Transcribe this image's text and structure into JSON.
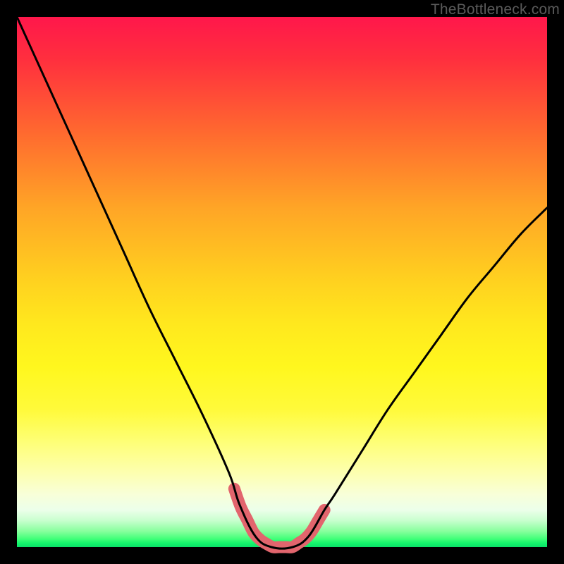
{
  "watermark": "TheBottleneck.com",
  "colors": {
    "curve": "#000000",
    "highlight": "#e2656d",
    "background_top": "#ff174b",
    "background_bottom": "#0ce06a",
    "frame": "#000000"
  },
  "chart_data": {
    "type": "line",
    "title": "",
    "xlabel": "",
    "ylabel": "",
    "xlim": [
      0,
      100
    ],
    "ylim": [
      0,
      100
    ],
    "grid": false,
    "legend": false,
    "annotations": [],
    "series": [
      {
        "name": "bottleneck-curve",
        "x": [
          0,
          5,
          10,
          15,
          20,
          25,
          30,
          35,
          40,
          42,
          45,
          48,
          52,
          55,
          58,
          60,
          65,
          70,
          75,
          80,
          85,
          90,
          95,
          100
        ],
        "values": [
          100,
          89,
          78,
          67,
          56,
          45,
          35,
          25,
          14,
          8,
          2,
          0,
          0,
          2,
          7,
          10,
          18,
          26,
          33,
          40,
          47,
          53,
          59,
          64
        ]
      }
    ],
    "highlight_segment": {
      "name": "optimal-range",
      "x_start": 41,
      "x_end": 58
    }
  }
}
